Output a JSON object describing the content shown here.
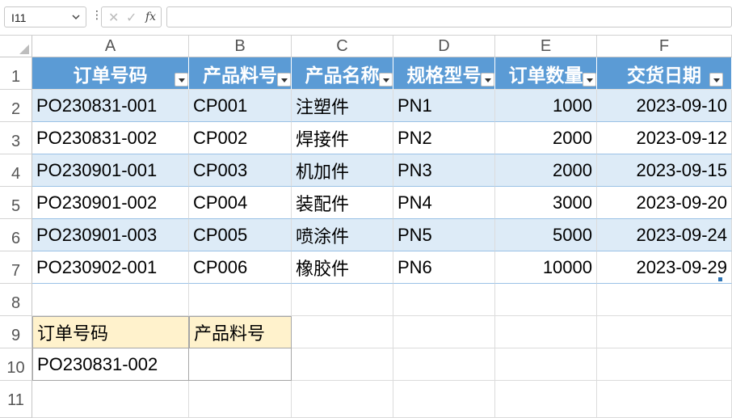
{
  "formula_bar": {
    "name_box": "I11",
    "formula": ""
  },
  "columns": [
    "A",
    "B",
    "C",
    "D",
    "E",
    "F"
  ],
  "rows": [
    "1",
    "2",
    "3",
    "4",
    "5",
    "6",
    "7",
    "8",
    "9",
    "10",
    "11"
  ],
  "table": {
    "headers": [
      "订单号码",
      "产品料号",
      "产品名称",
      "规格型号",
      "订单数量",
      "交货日期"
    ],
    "rows": [
      [
        "PO230831-001",
        "CP001",
        "注塑件",
        "PN1",
        "1000",
        "2023-09-10"
      ],
      [
        "PO230831-002",
        "CP002",
        "焊接件",
        "PN2",
        "2000",
        "2023-09-12"
      ],
      [
        "PO230901-001",
        "CP003",
        "机加件",
        "PN3",
        "2000",
        "2023-09-15"
      ],
      [
        "PO230901-002",
        "CP004",
        "装配件",
        "PN4",
        "3000",
        "2023-09-20"
      ],
      [
        "PO230901-003",
        "CP005",
        "喷涂件",
        "PN5",
        "5000",
        "2023-09-24"
      ],
      [
        "PO230902-001",
        "CP006",
        "橡胶件",
        "PN6",
        "10000",
        "2023-09-29"
      ]
    ],
    "header_color": "#5B9BD5",
    "band_color": "#DDEBF7"
  },
  "lookup": {
    "key_label": "订单号码",
    "value_label": "产品料号",
    "key_value": "PO230831-002",
    "value_result": "",
    "label_color": "#FFF2CC"
  }
}
